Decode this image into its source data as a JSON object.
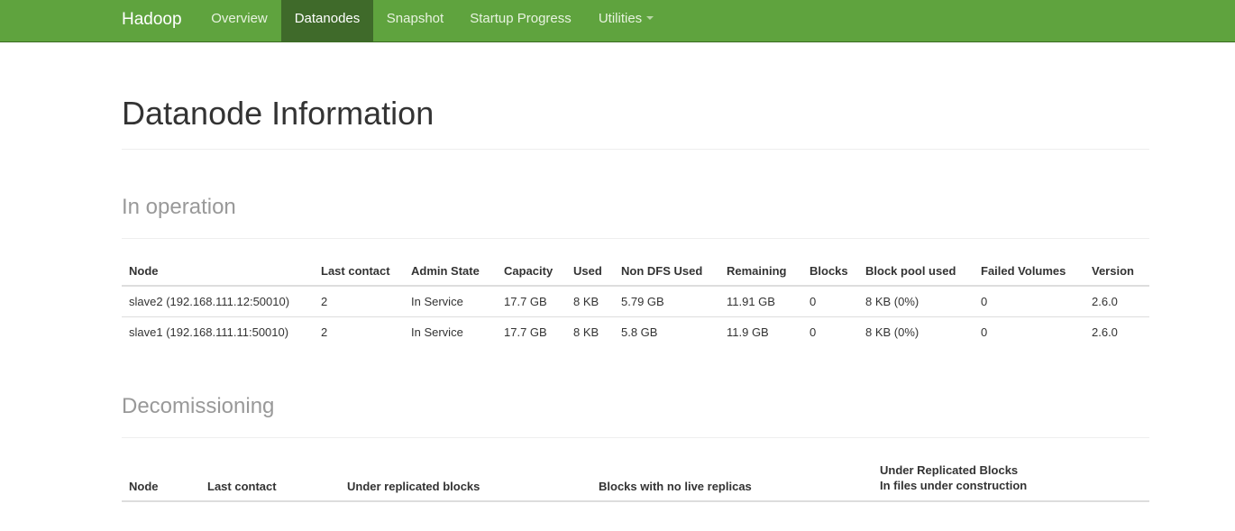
{
  "nav": {
    "brand": "Hadoop",
    "items": [
      {
        "label": "Overview"
      },
      {
        "label": "Datanodes"
      },
      {
        "label": "Snapshot"
      },
      {
        "label": "Startup Progress"
      },
      {
        "label": "Utilities"
      }
    ],
    "colors": {
      "bar": "#5fa33e",
      "active": "#3f6a2a"
    }
  },
  "page": {
    "title": "Datanode Information"
  },
  "in_operation": {
    "title": "In operation",
    "headers": [
      "Node",
      "Last contact",
      "Admin State",
      "Capacity",
      "Used",
      "Non DFS Used",
      "Remaining",
      "Blocks",
      "Block pool used",
      "Failed Volumes",
      "Version"
    ],
    "rows": [
      [
        "slave2 (192.168.111.12:50010)",
        "2",
        "In Service",
        "17.7 GB",
        "8 KB",
        "5.79 GB",
        "11.91 GB",
        "0",
        "8 KB (0%)",
        "0",
        "2.6.0"
      ],
      [
        "slave1 (192.168.111.11:50010)",
        "2",
        "In Service",
        "17.7 GB",
        "8 KB",
        "5.8 GB",
        "11.9 GB",
        "0",
        "8 KB (0%)",
        "0",
        "2.6.0"
      ]
    ]
  },
  "decommissioning": {
    "title": "Decomissioning",
    "headers": {
      "node": "Node",
      "last_contact": "Last contact",
      "under_replicated": "Under replicated blocks",
      "no_live_replicas": "Blocks with no live replicas",
      "under_construction_line1": "Under Replicated Blocks",
      "under_construction_line2": "In files under construction"
    }
  }
}
